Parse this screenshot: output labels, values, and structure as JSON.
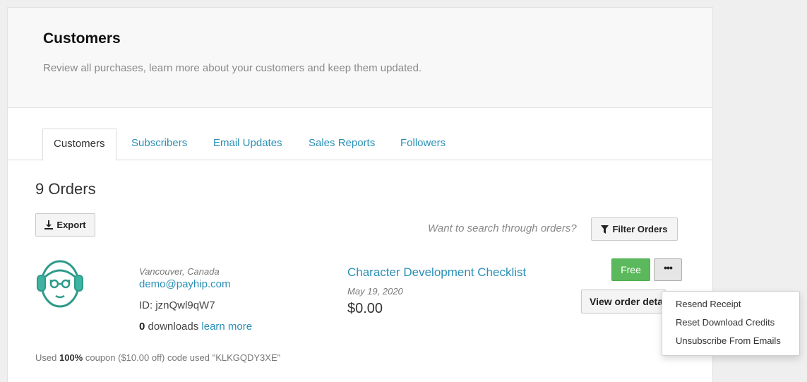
{
  "header": {
    "title": "Customers",
    "subtitle": "Review all purchases, learn more about your customers and keep them updated."
  },
  "tabs": [
    {
      "label": "Customers",
      "active": true
    },
    {
      "label": "Subscribers",
      "active": false
    },
    {
      "label": "Email Updates",
      "active": false
    },
    {
      "label": "Sales Reports",
      "active": false
    },
    {
      "label": "Followers",
      "active": false
    }
  ],
  "orders": {
    "count_label": "9 Orders",
    "export_label": "Export",
    "search_hint": "Want to search through orders?",
    "filter_label": "Filter Orders"
  },
  "order": {
    "avatar_icon": "customer-avatar-icon",
    "location": "Vancouver, Canada",
    "email": "demo@payhip.com",
    "id_label": "ID:",
    "id_value": "jznQwl9qW7",
    "downloads_count": "0",
    "downloads_label": "downloads",
    "learn_more": "learn more",
    "product_title": "Character Development Checklist",
    "date": "May 19, 2020",
    "price": "$0.00",
    "status_badge": "Free",
    "more_icon": "•••",
    "view_details_label": "View order details",
    "coupon_prefix": "Used",
    "coupon_percent": "100%",
    "coupon_suffix": "coupon ($10.00 off) code used \"KLKGQDY3XE\""
  },
  "menu": {
    "items": [
      "Resend Receipt",
      "Reset Download Credits",
      "Unsubscribe From Emails"
    ]
  },
  "colors": {
    "accent": "#2a8fb5",
    "success": "#5cb85c",
    "avatar": "#2e9a8a",
    "avatar_light": "#3fb3a1"
  }
}
